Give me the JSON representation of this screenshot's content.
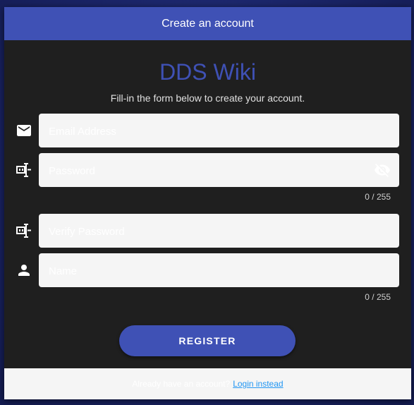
{
  "header": {
    "title": "Create an account"
  },
  "brand": {
    "name": "DDS Wiki",
    "color": "#3f51b5"
  },
  "form": {
    "subtitle": "Fill-in the form below to create your account.",
    "email": {
      "placeholder": "Email Address",
      "value": "",
      "icon": "email-icon"
    },
    "password": {
      "placeholder": "Password",
      "value": "",
      "icon": "password-icon",
      "toggle_icon": "visibility-off-icon",
      "counter": "0 / 255"
    },
    "verify_password": {
      "placeholder": "Verify Password",
      "value": "",
      "icon": "password-icon"
    },
    "name": {
      "placeholder": "Name",
      "value": "",
      "icon": "person-icon",
      "counter": "0 / 255"
    },
    "register_label": "REGISTER"
  },
  "footer": {
    "prompt": "Already have an account?",
    "login_label": "Login instead",
    "link_color": "#2196f3"
  }
}
